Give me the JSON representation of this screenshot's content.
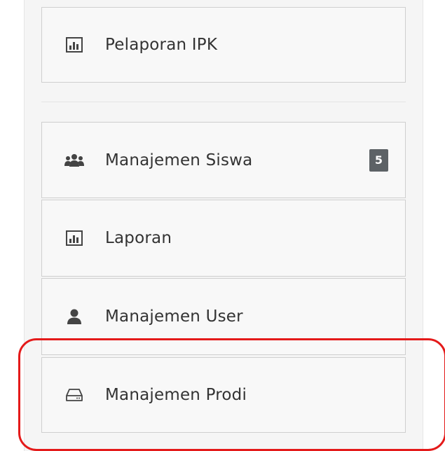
{
  "menu": {
    "items": [
      {
        "label": "Pelaporan IPK",
        "icon": "bar-chart-icon"
      },
      {
        "label": "Manajemen Siswa",
        "icon": "users-group-icon",
        "badge": "5"
      },
      {
        "label": "Laporan",
        "icon": "bar-chart-icon"
      },
      {
        "label": "Manajemen User",
        "icon": "user-icon"
      },
      {
        "label": "Manajemen Prodi",
        "icon": "hdd-drive-icon"
      }
    ]
  },
  "colors": {
    "highlight": "#e41a1a",
    "badge_bg": "#5d6266",
    "item_bg": "#f8f8f8",
    "item_border": "#cfcfcf",
    "text": "#333333"
  }
}
